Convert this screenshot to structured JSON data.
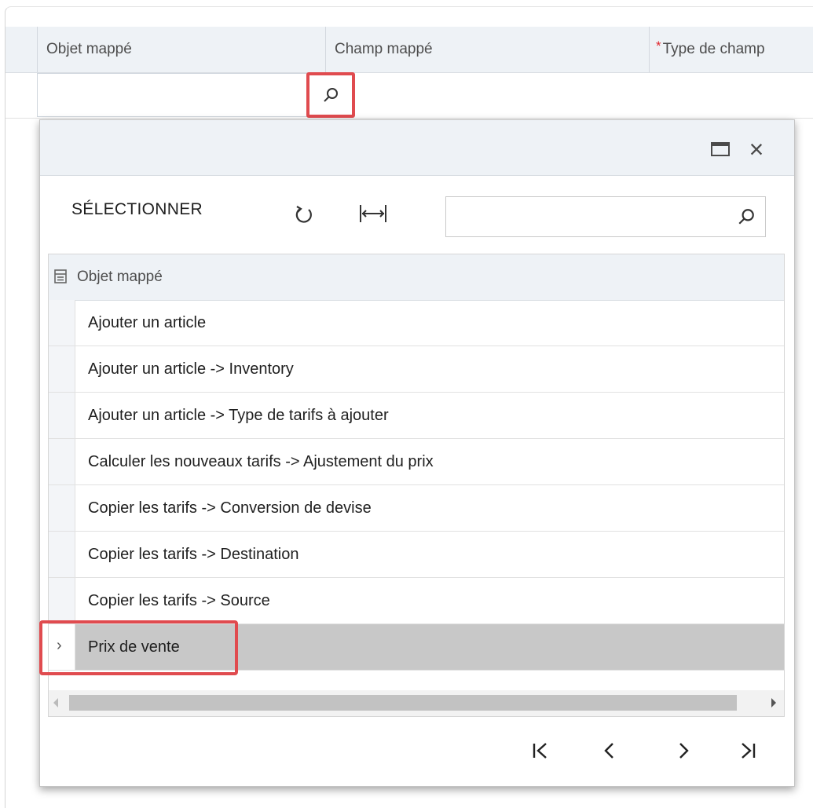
{
  "grid": {
    "columns": [
      {
        "label": "Objet mappé",
        "required": false
      },
      {
        "label": "Champ mappé",
        "required": false
      },
      {
        "label": "Type de champ",
        "required": true
      }
    ],
    "required_marker": "*"
  },
  "popup": {
    "toolbar": {
      "select_label": "SÉLECTIONNER",
      "search_value": ""
    },
    "table": {
      "header": "Objet mappé",
      "rows": [
        "Ajouter un article",
        "Ajouter un article -> Inventory",
        "Ajouter un article -> Type de tarifs à ajouter",
        "Calculer les nouveaux tarifs -> Ajustement du prix",
        "Copier les tarifs -> Conversion de devise",
        "Copier les tarifs -> Destination",
        "Copier les tarifs -> Source",
        "Prix de vente"
      ],
      "selected_index": 7
    },
    "pager": {
      "first": "|<",
      "prev": "<",
      "next": ">",
      "last": ">|"
    }
  },
  "colors": {
    "highlight": "#e04b4f",
    "header_bg": "#eef2f6",
    "selected_row": "#c8c8c8",
    "required_asterisk": "#e0262c"
  }
}
